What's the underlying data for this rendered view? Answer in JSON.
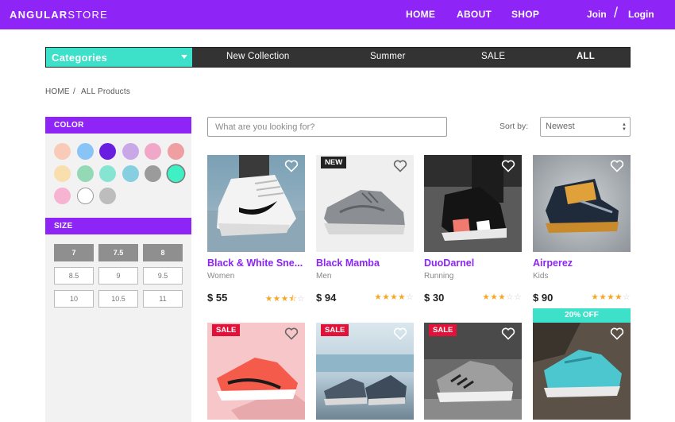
{
  "header": {
    "logo_bold": "ANGULAR",
    "logo_light": "STORE",
    "nav": [
      "HOME",
      "ABOUT",
      "SHOP"
    ],
    "join": "Join",
    "slash": "/",
    "login": "Login"
  },
  "categories": {
    "button_label": "Categories",
    "tabs": [
      "New Collection",
      "Summer",
      "SALE",
      "ALL"
    ]
  },
  "breadcrumb": {
    "home": "HOME",
    "sep": "/",
    "current": "ALL Products"
  },
  "filters": {
    "color_title": "COLOR",
    "colors": [
      "#f8cbb8",
      "#89c4f7",
      "#6a1fe0",
      "#c9a8e8",
      "#f1a8c8",
      "#ef9ea1",
      "#fadfae",
      "#93d9b5",
      "#86e5d2",
      "#86cfe0",
      "#9b9b9b",
      "#3ff0c5",
      "#f7b4d2",
      "#ffffff",
      "#bdbdbd"
    ],
    "size_title": "SIZE",
    "sizes": [
      "7",
      "7.5",
      "8",
      "8.5",
      "9",
      "9.5",
      "10",
      "10.5",
      "11"
    ]
  },
  "search": {
    "placeholder": "What are you looking for?"
  },
  "sort": {
    "label": "Sort by:",
    "selected": "Newest"
  },
  "products": [
    {
      "name": "Black & White Sne...",
      "category": "Women",
      "price": "$ 55",
      "rating": 3.5,
      "badge": ""
    },
    {
      "name": "Black Mamba",
      "category": "Men",
      "price": "$ 94",
      "rating": 4,
      "badge": "NEW"
    },
    {
      "name": "DuoDarnel",
      "category": "Running",
      "price": "$ 30",
      "rating": 3,
      "badge": ""
    },
    {
      "name": "Airperez",
      "category": "Kids",
      "price": "$ 90",
      "rating": 4,
      "badge": ""
    },
    {
      "name": "",
      "category": "",
      "price": "",
      "rating": 0,
      "badge": "SALE"
    },
    {
      "name": "",
      "category": "",
      "price": "",
      "rating": 0,
      "badge": "SALE"
    },
    {
      "name": "",
      "category": "",
      "price": "",
      "rating": 0,
      "badge": "SALE"
    },
    {
      "name": "",
      "category": "",
      "price": "",
      "rating": 0,
      "badge": "",
      "discount": "20% OFF"
    }
  ],
  "theme": {
    "primary": "#8e24f5",
    "accent": "#3de0c8",
    "star": "#f5a623",
    "sale": "#e0123a"
  }
}
